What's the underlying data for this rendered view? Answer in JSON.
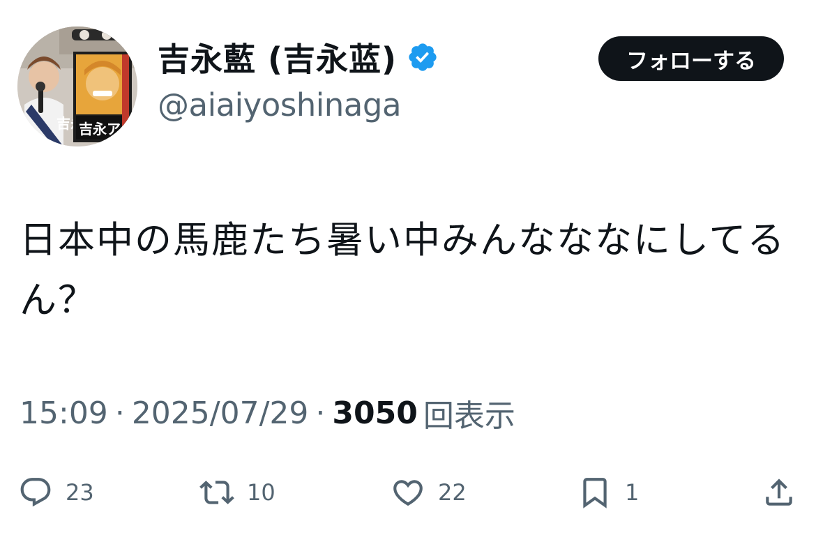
{
  "author": {
    "display_name": "吉永藍 (吉永蓝)",
    "handle": "@aiaiyoshinaga",
    "verified": true,
    "avatar_poster_text": "吉永ア",
    "avatar_sash_text": "吉永"
  },
  "follow_button": {
    "label": "フォローする"
  },
  "tweet": {
    "text": "日本中の馬鹿たち暑い中みんなななにしてるん？"
  },
  "meta": {
    "time": "15:09",
    "separator": "·",
    "date": "2025/07/29",
    "views_count": "3050",
    "views_label": "回表示"
  },
  "actions": {
    "reply_count": "23",
    "retweet_count": "10",
    "like_count": "22",
    "bookmark_count": "1"
  },
  "colors": {
    "text_primary": "#0f1419",
    "text_secondary": "#536471",
    "verified_blue": "#1d9bf0",
    "button_bg": "#0f1419",
    "button_text": "#ffffff"
  },
  "icons": {
    "reply": "reply-icon",
    "retweet": "retweet-icon",
    "like": "heart-icon",
    "bookmark": "bookmark-icon",
    "share": "share-icon",
    "verified": "verified-badge-icon"
  }
}
